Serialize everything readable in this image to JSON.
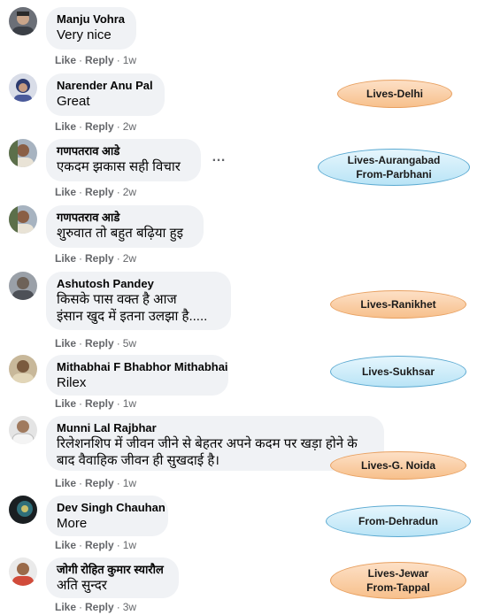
{
  "actions": {
    "like": "Like",
    "reply": "Reply",
    "separator": "·"
  },
  "comments": [
    {
      "author": "Manju Vohra",
      "lines": [
        "Very nice"
      ],
      "time": "1w"
    },
    {
      "author": "Narender Anu Pal",
      "lines": [
        "Great"
      ],
      "time": "2w"
    },
    {
      "author": "गणपतराव आडे",
      "lines": [
        "एकदम झकास सही विचार"
      ],
      "time": "2w"
    },
    {
      "author": "गणपतराव आडे",
      "lines": [
        "शुरुवात तो बहुत बढ़िया हुइ"
      ],
      "time": "2w"
    },
    {
      "author": "Ashutosh Pandey",
      "lines": [
        "किसके पास वक्त है आज",
        "इंसान खुद में इतना उलझा है....."
      ],
      "time": "5w"
    },
    {
      "author": "Mithabhai F Bhabhor Mithabhai",
      "lines": [
        "Rilex"
      ],
      "time": "1w"
    },
    {
      "author": "Munni Lal Rajbhar",
      "lines": [
        "रिलेशनशिप में जीवन जीने से बेहतर अपने कदम पर खड़ा होने के",
        "बाद वैवाहिक जीवन ही सुखदाई है।"
      ],
      "time": "1w"
    },
    {
      "author": "Dev Singh Chauhan",
      "lines": [
        "More"
      ],
      "time": "1w"
    },
    {
      "author": "जोगी रोहित कुमार स्यारौल",
      "lines": [
        "अति सुन्दर"
      ],
      "time": "3w"
    }
  ],
  "more_icon": "…",
  "tags": [
    {
      "lines": [
        "Lives-Delhi"
      ],
      "color": "#f7c08c"
    },
    {
      "lines": [
        "Lives-Aurangabad",
        "From-Parbhani"
      ],
      "color": "#b9e4f6"
    },
    {
      "lines": [
        "Lives-Ranikhet"
      ],
      "color": "#f7c08c"
    },
    {
      "lines": [
        "Lives-Sukhsar"
      ],
      "color": "#b9e4f6"
    },
    {
      "lines": [
        "Lives-G. Noida"
      ],
      "color": "#f7c08c"
    },
    {
      "lines": [
        "From-Dehradun"
      ],
      "color": "#b9e4f6"
    },
    {
      "lines": [
        "Lives-Jewar",
        "From-Tappal"
      ],
      "color": "#f7c08c"
    }
  ]
}
